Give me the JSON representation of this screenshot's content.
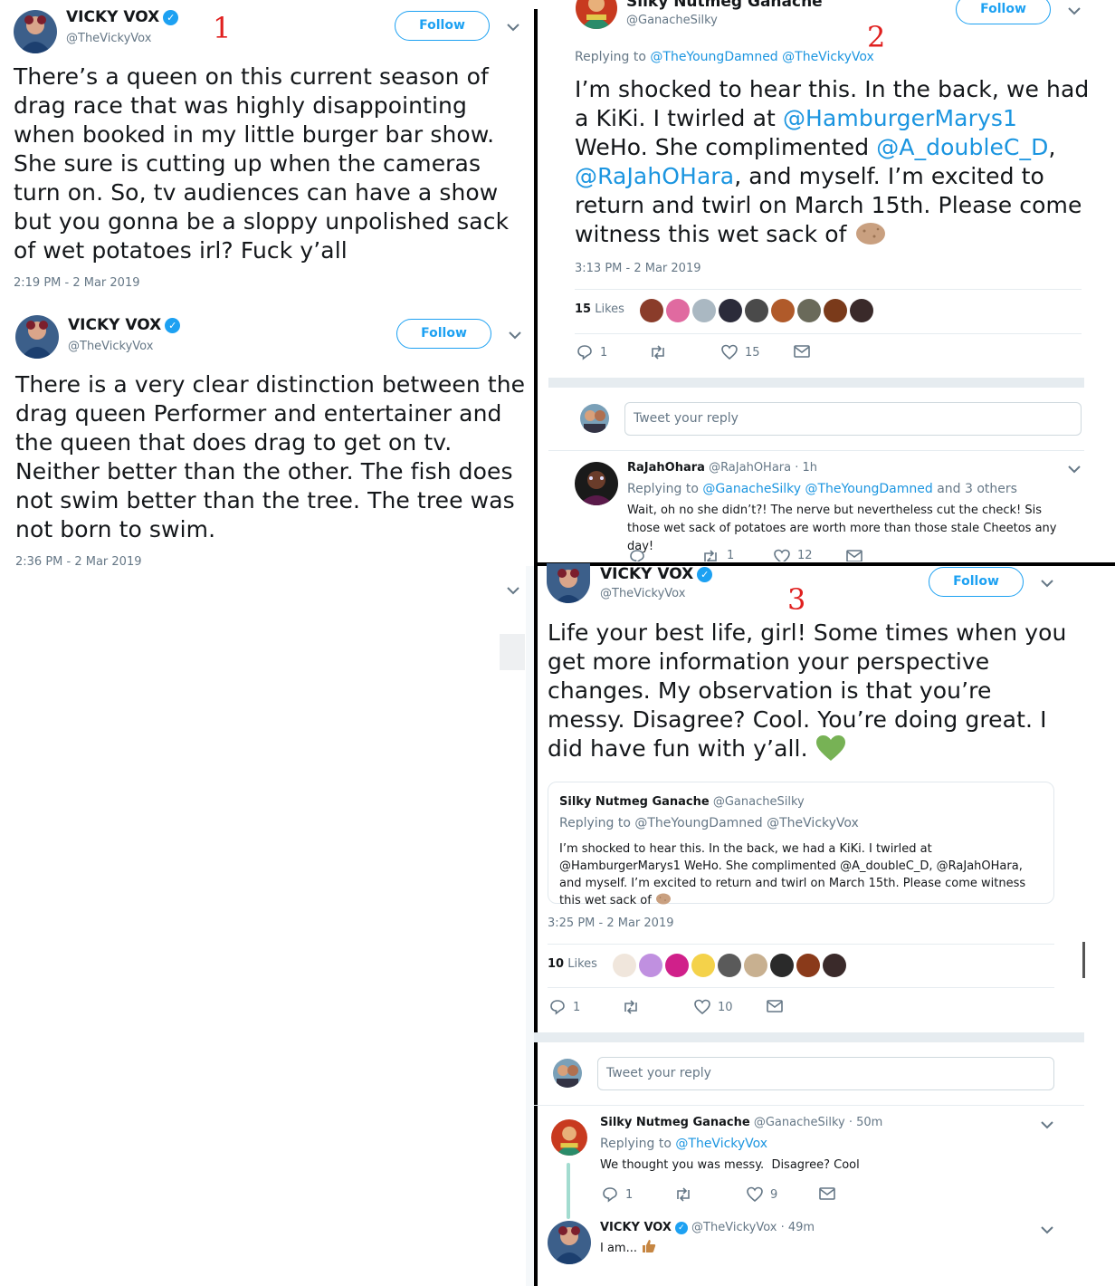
{
  "numbers": {
    "one": "1",
    "two": "2",
    "three": "3"
  },
  "follow_label": "Follow",
  "tweet1": {
    "name": "VICKY VOX",
    "handle": "@TheVickyVox",
    "text": "There’s a queen on this current season of drag race that was highly disappointing when booked in my little burger bar show. She sure is cutting up when the cameras turn on. So, tv audiences can have a show but you gonna be a sloppy unpolished sack of wet potatoes irl? Fuck y’all",
    "time": "2:19 PM - 2 Mar 2019"
  },
  "tweet1b": {
    "name": "VICKY VOX",
    "handle": "@TheVickyVox",
    "text": "There is a very clear distinction between the drag queen Performer and entertainer and the queen that does drag to get on tv. Neither better than the other. The fish does not swim better than the tree. The tree was not born to swim.",
    "time": "2:36 PM - 2 Mar 2019"
  },
  "tweet2": {
    "name": "Silky Nutmeg Ganache",
    "handle": "@GanacheSilky",
    "replying_prefix": "Replying to",
    "replying_to": "@TheYoungDamned @TheVickyVox",
    "text_parts": [
      "I’m shocked to hear this. In the back, we had a KiKi. I twirled at ",
      "@HamburgerMarys1",
      " WeHo. She complimented ",
      "@A_doubleC_D",
      ", ",
      "@RaJahOHara",
      ", and myself. I’m excited to return and twirl on March 15th. Please come witness this wet sack of "
    ],
    "emoji": "potato",
    "time": "3:13 PM - 2 Mar 2019",
    "likes_count": "15",
    "likes_label": "Likes",
    "replies": "1",
    "retweets": "",
    "like_count": "15",
    "reply_placeholder": "Tweet your reply",
    "reply": {
      "name": "RaJahOhara",
      "handle": "@RaJahOHara · 1h",
      "replying_prefix": "Replying to",
      "replying_to": "@GanacheSilky @TheYoungDamned",
      "replying_suffix": "and 3 others",
      "text": "Wait, oh no she didn’t?! The nerve but nevertheless cut the check! Sis those wet sack of potatoes are worth more than those stale Cheetos any day!",
      "retweets": "1",
      "likes": "12"
    }
  },
  "tweet3": {
    "name": "VICKY VOX",
    "handle": "@TheVickyVox",
    "text": "Life your best life, girl! Some times when you get more information your perspective changes. My observation is that you’re messy. Disagree? Cool. You’re doing great. I did have fun with y’all.",
    "emoji": "green-heart",
    "quote": {
      "name": "Silky Nutmeg Ganache",
      "handle": "@GanacheSilky",
      "replying": "Replying to @TheYoungDamned @TheVickyVox",
      "text": "I’m shocked to hear this. In the back, we had a KiKi. I twirled at @HamburgerMarys1 WeHo. She complimented @A_doubleC_D, @RaJahOHara, and myself. I’m excited to return and twirl on March 15th. Please come witness this wet sack of"
    },
    "time": "3:25 PM - 2 Mar 2019",
    "likes_count": "10",
    "likes_label": "Likes",
    "replies": "1",
    "like_count": "10",
    "reply_placeholder": "Tweet your reply",
    "reply1": {
      "name": "Silky Nutmeg Ganache",
      "handle": "@GanacheSilky · 50m",
      "replying_prefix": "Replying to",
      "replying_to": "@TheVickyVox",
      "text": "We thought you was messy.  Disagree? Cool",
      "replies": "1",
      "likes": "9"
    },
    "reply2": {
      "name": "VICKY VOX",
      "handle": "@TheVickyVox · 49m",
      "text": "I am..."
    }
  },
  "colors": {
    "accent": "#1da1f2",
    "link": "#1b95e0",
    "number": "#e0201f",
    "heart": "#77b255"
  }
}
